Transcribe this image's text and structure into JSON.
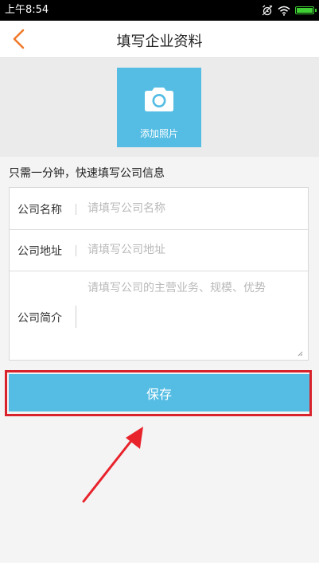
{
  "status_bar": {
    "time": "上午8:54",
    "icons": [
      "alarm-icon",
      "wifi-icon",
      "battery-icon"
    ],
    "battery_color": "#3fcf35"
  },
  "nav": {
    "title": "填写企业资料",
    "back_icon": "chevron-left-icon",
    "accent": "#f07a2a"
  },
  "photo": {
    "label": "添加照片",
    "icon": "camera-icon",
    "color": "#55bde4"
  },
  "form": {
    "hint": "只需一分钟，快速填写公司信息",
    "fields": [
      {
        "label": "公司名称",
        "placeholder": "请填写公司名称",
        "value": ""
      },
      {
        "label": "公司地址",
        "placeholder": "请填写公司地址",
        "value": ""
      },
      {
        "label": "公司简介",
        "placeholder": "请填写公司的主营业务、规模、优势",
        "value": ""
      }
    ]
  },
  "save": {
    "label": "保存",
    "color": "#55bde4",
    "highlight_color": "#d9232c"
  }
}
